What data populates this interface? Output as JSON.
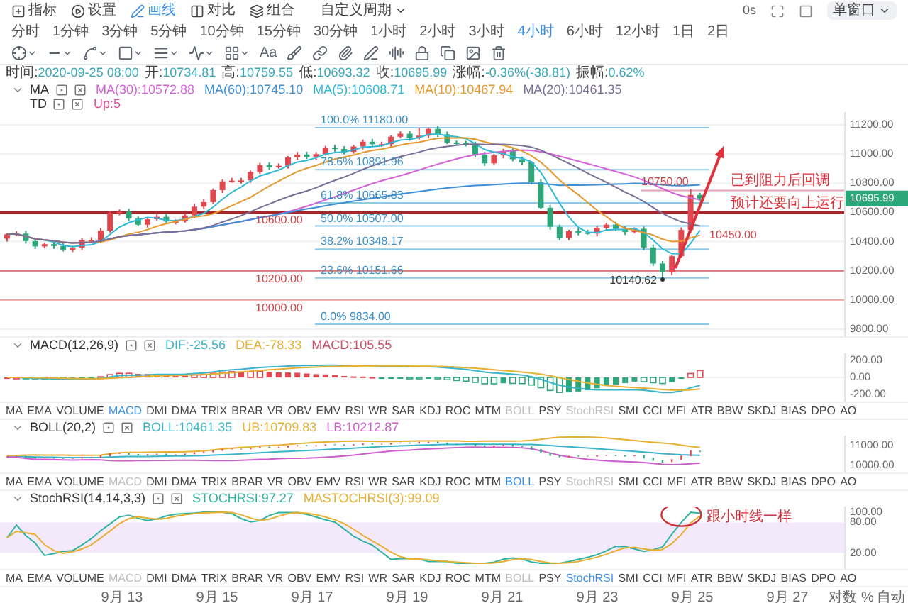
{
  "toolbar": {
    "tools": [
      {
        "label": "指标",
        "selected": false
      },
      {
        "label": "设置",
        "selected": false
      },
      {
        "label": "画线",
        "selected": true
      },
      {
        "label": "对比",
        "selected": false
      },
      {
        "label": "组合",
        "selected": false
      }
    ],
    "custom_period": "自定义周期",
    "timer": "0s",
    "window_mode": "单窗口",
    "periods": [
      {
        "label": "分时",
        "selected": false
      },
      {
        "label": "1分钟",
        "selected": false
      },
      {
        "label": "3分钟",
        "selected": false
      },
      {
        "label": "5分钟",
        "selected": false
      },
      {
        "label": "10分钟",
        "selected": false
      },
      {
        "label": "15分钟",
        "selected": false
      },
      {
        "label": "30分钟",
        "selected": false
      },
      {
        "label": "1小时",
        "selected": false
      },
      {
        "label": "2小时",
        "selected": false
      },
      {
        "label": "3小时",
        "selected": false
      },
      {
        "label": "4小时",
        "selected": true
      },
      {
        "label": "6小时",
        "selected": false
      },
      {
        "label": "12小时",
        "selected": false
      },
      {
        "label": "1日",
        "selected": false
      },
      {
        "label": "2日",
        "selected": false
      }
    ],
    "text_tool": "Aa"
  },
  "quote": [
    {
      "label": "时间:",
      "value": "2020-09-25 08:00"
    },
    {
      "label": "开:",
      "value": "10734.81"
    },
    {
      "label": "高:",
      "value": "10759.55"
    },
    {
      "label": "低:",
      "value": "10693.32"
    },
    {
      "label": "收:",
      "value": "10695.99"
    },
    {
      "label": "涨幅:",
      "value": "-0.36%(-38.81)"
    },
    {
      "label": "振幅:",
      "value": "0.62%"
    }
  ],
  "legends": [
    {
      "name": "MA",
      "collapsible": true,
      "values": [
        {
          "text": "MA(30):10572.88",
          "color": "#d660d6"
        },
        {
          "text": "MA(60):10745.10",
          "color": "#3d8fd6"
        },
        {
          "text": "MA(5):10608.71",
          "color": "#2fb8d8"
        },
        {
          "text": "MA(10):10467.94",
          "color": "#e69a2e"
        },
        {
          "text": "MA(20):10461.35",
          "color": "#7a6f96"
        }
      ]
    },
    {
      "name": "TD",
      "collapsible": false,
      "values": [
        {
          "text": "Up:5",
          "color": "#e0509a"
        }
      ]
    }
  ],
  "main_chart": {
    "axis": [
      "11200.00",
      "11000.00",
      "10800.00",
      "10600.00",
      "10400.00",
      "10200.00",
      "10000.00",
      "9800.00"
    ],
    "fib_levels": [
      "100.0% 11180.00",
      "78.6% 10891.96",
      "61.8% 10665.83",
      "50.0% 10507.00",
      "38.2% 10348.17",
      "23.6% 10151.66",
      "0.0% 9834.00"
    ],
    "price_lines": [
      "10600.00",
      "10200.00",
      "10000.00"
    ],
    "marks": [
      "10750.00",
      "10450.00",
      "10140.62"
    ],
    "last_price": "10695.99",
    "notes": [
      "已到阻力后回调",
      "预计还要向上运行"
    ]
  },
  "panels": [
    {
      "kind": "macd",
      "title": "MACD(12,26,9)",
      "collapsible": true,
      "values": [
        {
          "text": "DIF:-25.56",
          "color": "#3ab5c8"
        },
        {
          "text": "DEA:-78.33",
          "color": "#e6b032"
        },
        {
          "text": "MACD:105.55",
          "color": "#d04e6a"
        }
      ],
      "axis": [
        "200.00",
        "0.00",
        "-200.00"
      ],
      "tabs": [
        {
          "label": "MA",
          "selected": false,
          "disabled": false
        },
        {
          "label": "EMA",
          "selected": false,
          "disabled": false
        },
        {
          "label": "VOLUME",
          "selected": false,
          "disabled": false
        },
        {
          "label": "MACD",
          "selected": true,
          "disabled": false
        },
        {
          "label": "DMI",
          "selected": false,
          "disabled": false
        },
        {
          "label": "DMA",
          "selected": false,
          "disabled": false
        },
        {
          "label": "TRIX",
          "selected": false,
          "disabled": false
        },
        {
          "label": "BRAR",
          "selected": false,
          "disabled": false
        },
        {
          "label": "VR",
          "selected": false,
          "disabled": false
        },
        {
          "label": "OBV",
          "selected": false,
          "disabled": false
        },
        {
          "label": "EMV",
          "selected": false,
          "disabled": false
        },
        {
          "label": "RSI",
          "selected": false,
          "disabled": false
        },
        {
          "label": "WR",
          "selected": false,
          "disabled": false
        },
        {
          "label": "SAR",
          "selected": false,
          "disabled": false
        },
        {
          "label": "KDJ",
          "selected": false,
          "disabled": false
        },
        {
          "label": "ROC",
          "selected": false,
          "disabled": false
        },
        {
          "label": "MTM",
          "selected": false,
          "disabled": false
        },
        {
          "label": "BOLL",
          "selected": false,
          "disabled": true
        },
        {
          "label": "PSY",
          "selected": false,
          "disabled": false
        },
        {
          "label": "StochRSI",
          "selected": false,
          "disabled": true
        },
        {
          "label": "SMI",
          "selected": false,
          "disabled": false
        },
        {
          "label": "CCI",
          "selected": false,
          "disabled": false
        },
        {
          "label": "MFI",
          "selected": false,
          "disabled": false
        },
        {
          "label": "ATR",
          "selected": false,
          "disabled": false
        },
        {
          "label": "BBW",
          "selected": false,
          "disabled": false
        },
        {
          "label": "SKDJ",
          "selected": false,
          "disabled": false
        },
        {
          "label": "BIAS",
          "selected": false,
          "disabled": false
        },
        {
          "label": "DPO",
          "selected": false,
          "disabled": false
        },
        {
          "label": "AO",
          "selected": false,
          "disabled": false
        }
      ]
    },
    {
      "kind": "boll",
      "title": "BOLL(20,2)",
      "collapsible": true,
      "values": [
        {
          "text": "BOLL:10461.35",
          "color": "#3ab5c8"
        },
        {
          "text": "UB:10709.83",
          "color": "#e6b032"
        },
        {
          "text": "LB:10212.87",
          "color": "#cc5fcc"
        }
      ],
      "axis": [
        "11000.00",
        "10000.00"
      ],
      "tabs": [
        {
          "label": "MA",
          "selected": false,
          "disabled": false
        },
        {
          "label": "EMA",
          "selected": false,
          "disabled": false
        },
        {
          "label": "VOLUME",
          "selected": false,
          "disabled": false
        },
        {
          "label": "MACD",
          "selected": false,
          "disabled": true
        },
        {
          "label": "DMI",
          "selected": false,
          "disabled": false
        },
        {
          "label": "DMA",
          "selected": false,
          "disabled": false
        },
        {
          "label": "TRIX",
          "selected": false,
          "disabled": false
        },
        {
          "label": "BRAR",
          "selected": false,
          "disabled": false
        },
        {
          "label": "VR",
          "selected": false,
          "disabled": false
        },
        {
          "label": "OBV",
          "selected": false,
          "disabled": false
        },
        {
          "label": "EMV",
          "selected": false,
          "disabled": false
        },
        {
          "label": "RSI",
          "selected": false,
          "disabled": false
        },
        {
          "label": "WR",
          "selected": false,
          "disabled": false
        },
        {
          "label": "SAR",
          "selected": false,
          "disabled": false
        },
        {
          "label": "KDJ",
          "selected": false,
          "disabled": false
        },
        {
          "label": "ROC",
          "selected": false,
          "disabled": false
        },
        {
          "label": "MTM",
          "selected": false,
          "disabled": false
        },
        {
          "label": "BOLL",
          "selected": true,
          "disabled": false
        },
        {
          "label": "PSY",
          "selected": false,
          "disabled": false
        },
        {
          "label": "StochRSI",
          "selected": false,
          "disabled": true
        },
        {
          "label": "SMI",
          "selected": false,
          "disabled": false
        },
        {
          "label": "CCI",
          "selected": false,
          "disabled": false
        },
        {
          "label": "MFI",
          "selected": false,
          "disabled": false
        },
        {
          "label": "ATR",
          "selected": false,
          "disabled": false
        },
        {
          "label": "BBW",
          "selected": false,
          "disabled": false
        },
        {
          "label": "SKDJ",
          "selected": false,
          "disabled": false
        },
        {
          "label": "BIAS",
          "selected": false,
          "disabled": false
        },
        {
          "label": "DPO",
          "selected": false,
          "disabled": false
        },
        {
          "label": "AO",
          "selected": false,
          "disabled": false
        }
      ]
    },
    {
      "kind": "stochrsi",
      "title": "StochRSI(14,14,3,3)",
      "collapsible": true,
      "values": [
        {
          "text": "STOCHRSI:97.27",
          "color": "#2fb3a0"
        },
        {
          "text": "MASTOCHRSI(3):99.09",
          "color": "#e6b032"
        }
      ],
      "axis": [
        "100.00",
        "80.00",
        "20.00"
      ],
      "note": "跟小时线一样",
      "tabs": [
        {
          "label": "MA",
          "selected": false,
          "disabled": false
        },
        {
          "label": "EMA",
          "selected": false,
          "disabled": false
        },
        {
          "label": "VOLUME",
          "selected": false,
          "disabled": false
        },
        {
          "label": "MACD",
          "selected": false,
          "disabled": true
        },
        {
          "label": "DMI",
          "selected": false,
          "disabled": false
        },
        {
          "label": "DMA",
          "selected": false,
          "disabled": false
        },
        {
          "label": "TRIX",
          "selected": false,
          "disabled": false
        },
        {
          "label": "BRAR",
          "selected": false,
          "disabled": false
        },
        {
          "label": "VR",
          "selected": false,
          "disabled": false
        },
        {
          "label": "OBV",
          "selected": false,
          "disabled": false
        },
        {
          "label": "EMV",
          "selected": false,
          "disabled": false
        },
        {
          "label": "RSI",
          "selected": false,
          "disabled": false
        },
        {
          "label": "WR",
          "selected": false,
          "disabled": false
        },
        {
          "label": "SAR",
          "selected": false,
          "disabled": false
        },
        {
          "label": "KDJ",
          "selected": false,
          "disabled": false
        },
        {
          "label": "ROC",
          "selected": false,
          "disabled": false
        },
        {
          "label": "MTM",
          "selected": false,
          "disabled": false
        },
        {
          "label": "BOLL",
          "selected": false,
          "disabled": true
        },
        {
          "label": "PSY",
          "selected": false,
          "disabled": false
        },
        {
          "label": "StochRSI",
          "selected": true,
          "disabled": false
        },
        {
          "label": "SMI",
          "selected": false,
          "disabled": false
        },
        {
          "label": "CCI",
          "selected": false,
          "disabled": false
        },
        {
          "label": "MFI",
          "selected": false,
          "disabled": false
        },
        {
          "label": "ATR",
          "selected": false,
          "disabled": false
        },
        {
          "label": "BBW",
          "selected": false,
          "disabled": false
        },
        {
          "label": "SKDJ",
          "selected": false,
          "disabled": false
        },
        {
          "label": "BIAS",
          "selected": false,
          "disabled": false
        },
        {
          "label": "DPO",
          "selected": false,
          "disabled": false
        },
        {
          "label": "AO",
          "selected": false,
          "disabled": false
        }
      ]
    }
  ],
  "time_axis": {
    "dates": [
      "9月 13",
      "9月 15",
      "9月 17",
      "9月 19",
      "9月 21",
      "9月 23",
      "9月 25",
      "9月 27"
    ],
    "scale_options": [
      "对数",
      "%",
      "自动"
    ]
  }
}
